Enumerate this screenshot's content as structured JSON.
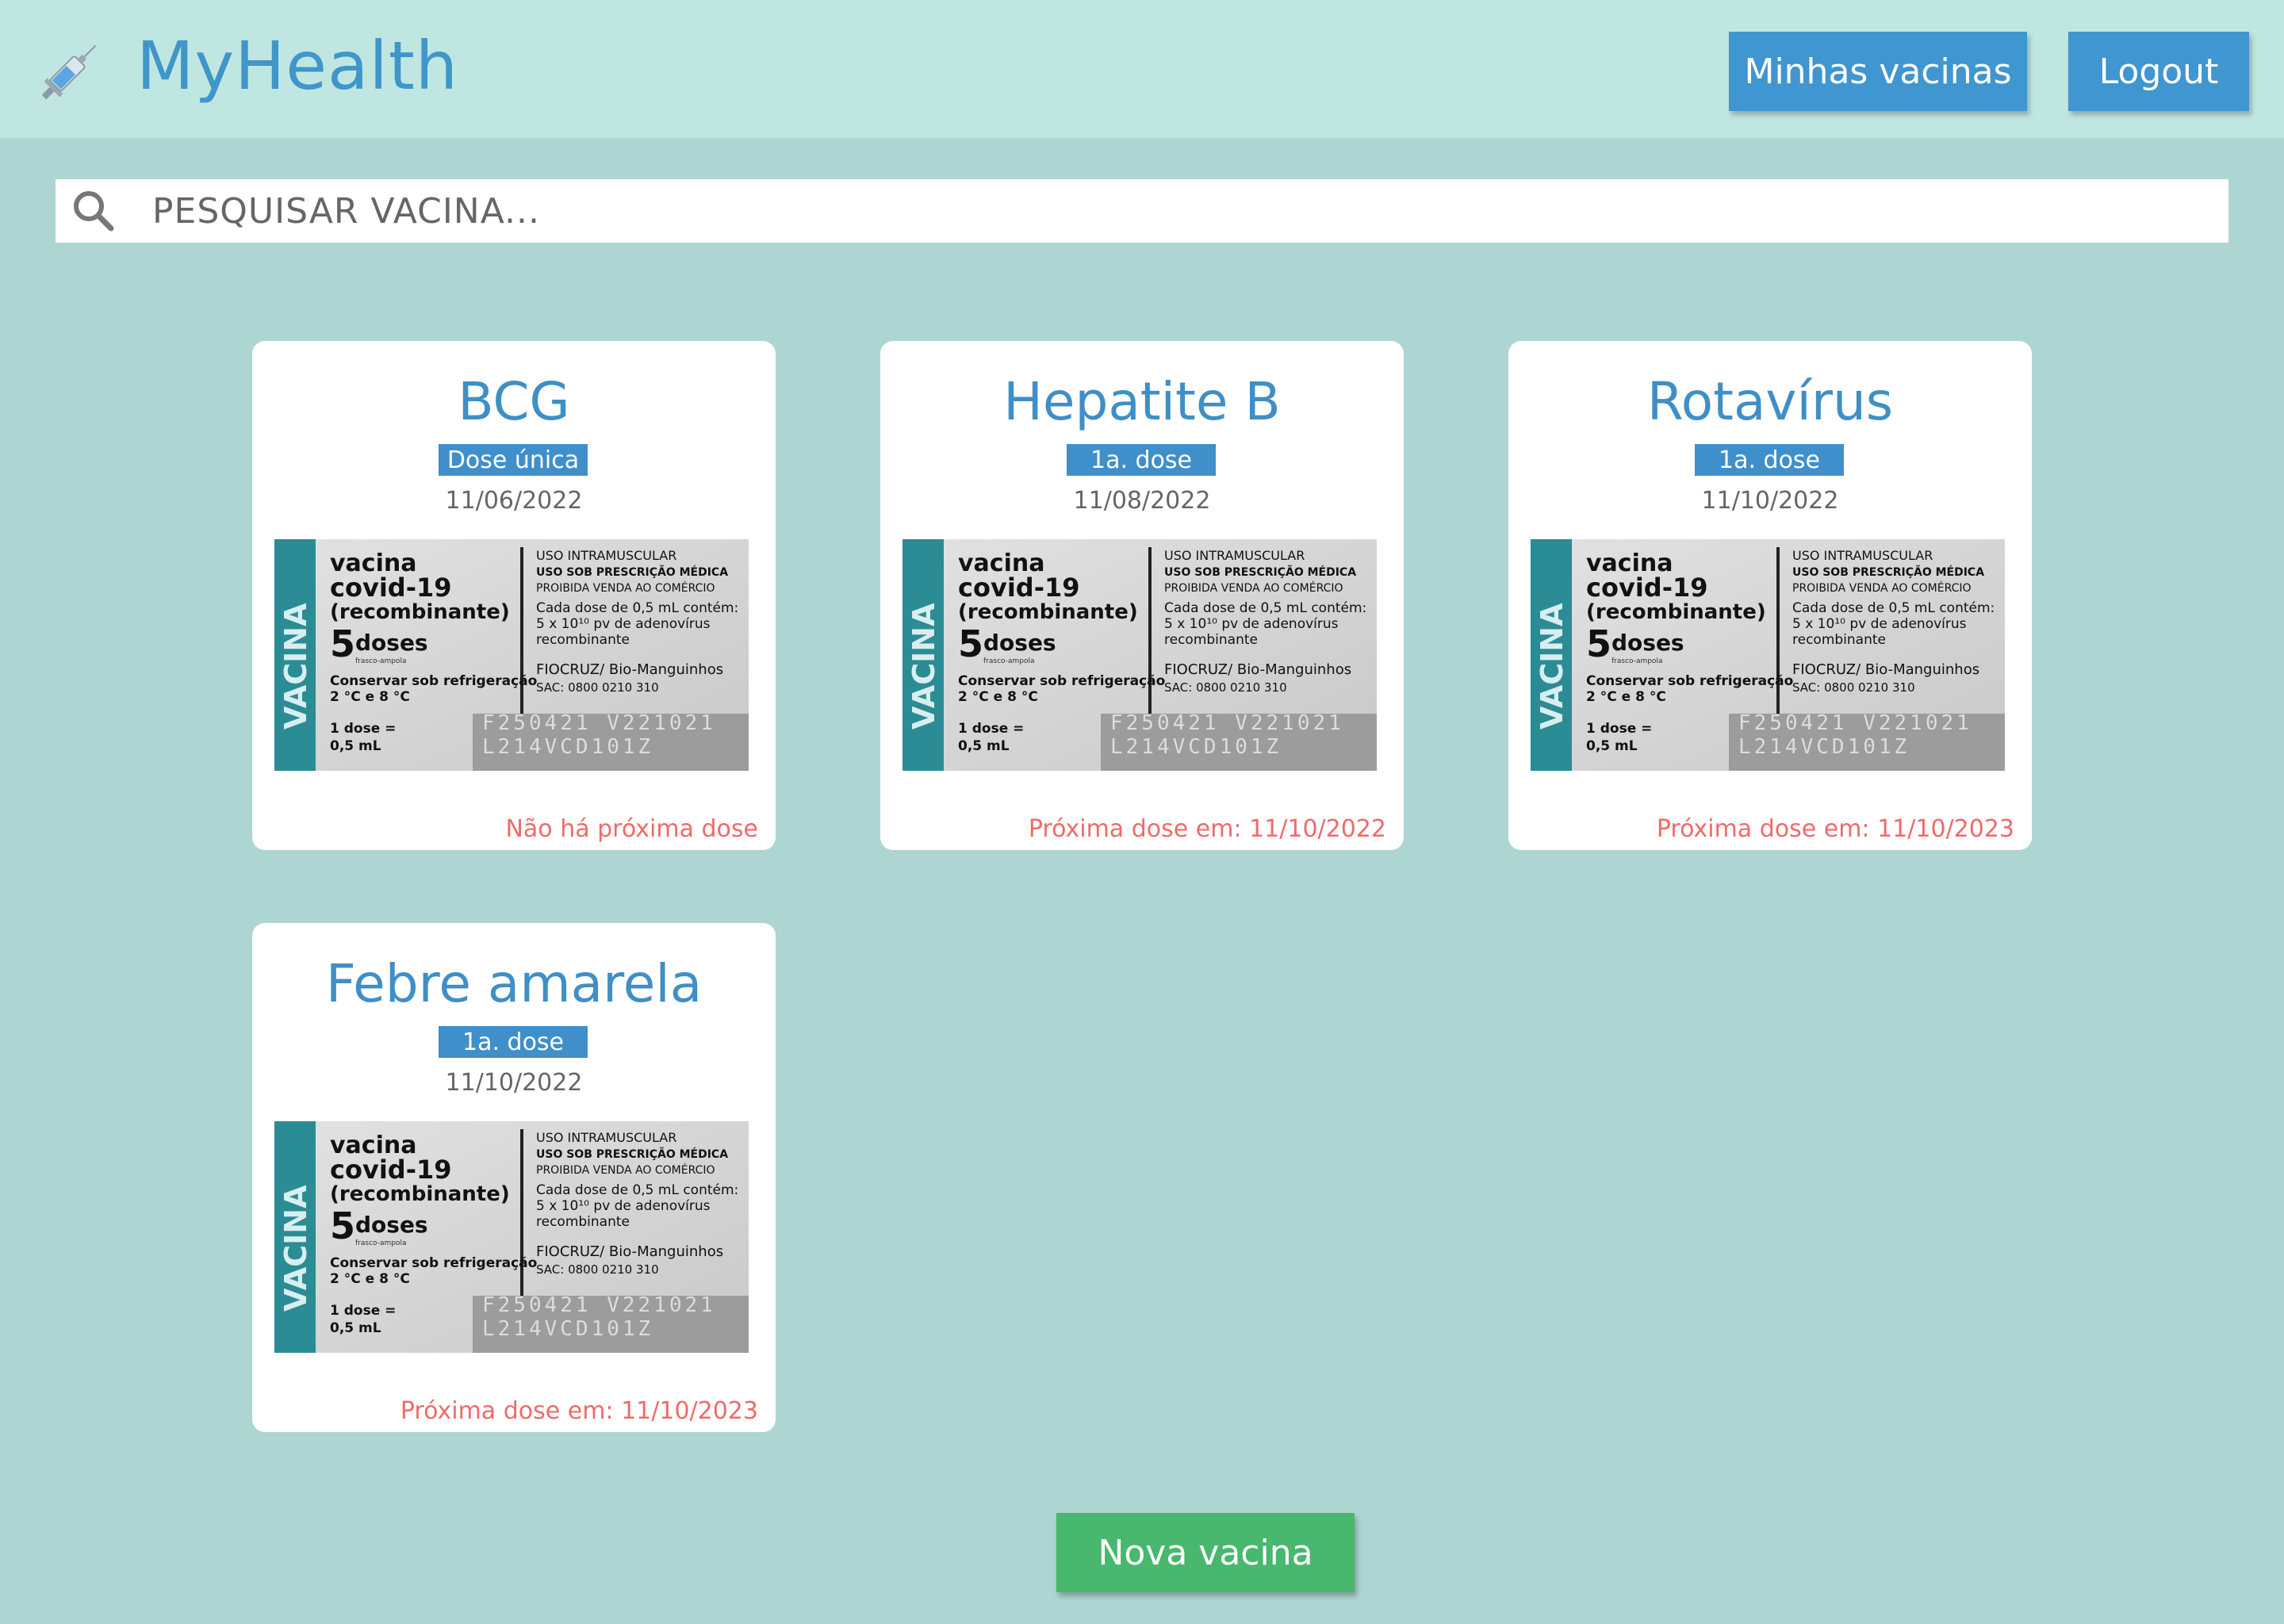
{
  "app": {
    "title": "MyHealth",
    "logo_icon": "syringe-icon"
  },
  "nav": {
    "my_vaccines_label": "Minhas vacinas",
    "logout_label": "Logout"
  },
  "search": {
    "icon": "search-icon",
    "placeholder": "PESQUISAR VACINA...",
    "value": ""
  },
  "vaccines": [
    {
      "name": "BCG",
      "dose": "Dose única",
      "date": "11/06/2022",
      "next_dose": "Não há próxima dose"
    },
    {
      "name": "Hepatite B",
      "dose": "1a. dose",
      "date": "11/08/2022",
      "next_dose": "Próxima dose em: 11/10/2022"
    },
    {
      "name": "Rotavírus",
      "dose": "1a. dose",
      "date": "11/10/2022",
      "next_dose": "Próxima dose em: 11/10/2023"
    },
    {
      "name": "Febre amarela",
      "dose": "1a. dose",
      "date": "11/10/2022",
      "next_dose": "Próxima dose em: 11/10/2023"
    }
  ],
  "vaccine_label": {
    "side": "VACINA",
    "l1": "vacina",
    "l2": "covid-19",
    "l3": "(recombinante)",
    "l4_num": "5",
    "l4": "doses",
    "l4b": "frasco-ampola",
    "l5": "Conservar sob refrigeração",
    "l6": "2 °C e 8 °C",
    "l7": "1 dose =",
    "l8": "0,5 mL",
    "r1": "USO INTRAMUSCULAR",
    "r2": "USO SOB PRESCRIÇÃO MÉDICA",
    "r3": "PROIBIDA VENDA AO COMÉRCIO",
    "r4": "Cada dose de 0,5 mL contém:",
    "r5": "5 x 10¹⁰ pv de adenovírus",
    "r6": "recombinante",
    "r7": "FIOCRUZ/ Bio-Manguinhos",
    "r8": "SAC: 0800 0210 310",
    "r9": "F250421 V221021",
    "r10": "L214VCD101Z"
  },
  "actions": {
    "new_vaccine_label": "Nova vacina"
  },
  "colors": {
    "header_bg": "#c0e6e2",
    "page_bg": "#add5d2",
    "primary": "#3f96d1",
    "success": "#47b86e",
    "next_dose_text": "#f06a6a"
  }
}
